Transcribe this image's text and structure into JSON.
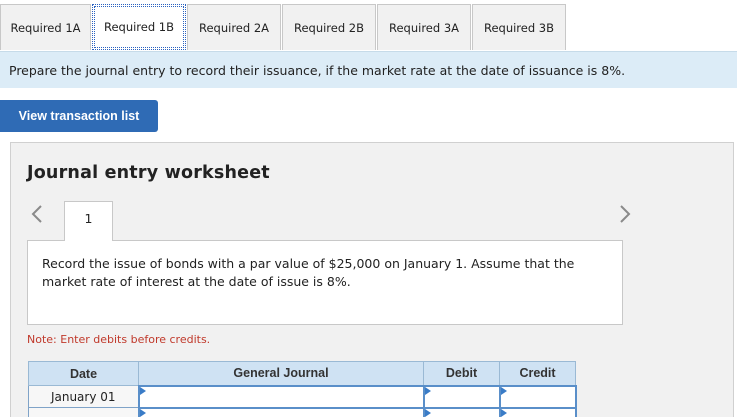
{
  "tabs": [
    {
      "label": "Required 1A",
      "active": false
    },
    {
      "label": "Required 1B",
      "active": true
    },
    {
      "label": "Required 2A",
      "active": false
    },
    {
      "label": "Required 2B",
      "active": false
    },
    {
      "label": "Required 3A",
      "active": false
    },
    {
      "label": "Required 3B",
      "active": false
    }
  ],
  "instruction": "Prepare the journal entry to record their issuance, if the market rate at the date of issuance is 8%.",
  "view_transactions_label": "View transaction list",
  "worksheet": {
    "title": "Journal entry worksheet",
    "entry_number": "1",
    "description": "Record the issue of bonds with a par value of $25,000 on January 1. Assume that the market rate of interest at the date of issue is 8%.",
    "note": "Note: Enter debits before credits.",
    "table": {
      "headers": {
        "date": "Date",
        "general_journal": "General Journal",
        "debit": "Debit",
        "credit": "Credit"
      },
      "rows": [
        {
          "date": "January 01",
          "account": "",
          "debit": "",
          "credit": ""
        },
        {
          "date": "",
          "account": "",
          "debit": "",
          "credit": ""
        }
      ]
    }
  },
  "icons": {
    "prev": "chevron-left-icon",
    "next": "chevron-right-icon"
  },
  "colors": {
    "accent": "#2f6bb5",
    "instruction_bg": "#dcecf7",
    "note": "#c0392b",
    "table_header": "#cfe2f3"
  }
}
